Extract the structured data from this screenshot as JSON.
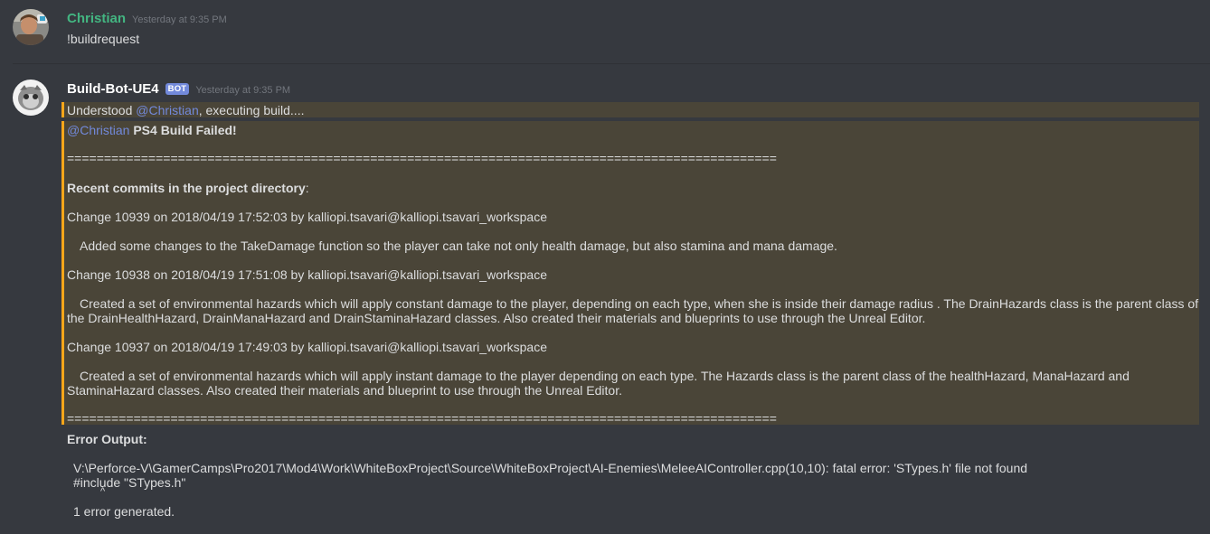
{
  "message1": {
    "username": "Christian",
    "username_color": "#43b581",
    "timestamp": "Yesterday at 9:35 PM",
    "content": "!buildrequest"
  },
  "message2": {
    "username": "Build-Bot-UE4",
    "username_color": "#ffffff",
    "bot_tag": "BOT",
    "timestamp": "Yesterday at 9:35 PM",
    "line1_prefix": "Understood ",
    "line1_mention": "@Christian",
    "line1_suffix": ", executing build....",
    "block": {
      "mention": "@Christian",
      "title": "PS4 Build Failed!",
      "separator": "================================================================================================",
      "recent_label": "Recent commits in the project directory",
      "recent_colon": ":",
      "commits": [
        {
          "change": "Change 10939 on 2018/04/19 17:52:03 by kalliopi.tsavari@kalliopi.tsavari_workspace",
          "description": "Added some changes to the TakeDamage function so the player can take not only health damage, but also stamina and mana damage."
        },
        {
          "change": "Change 10938 on 2018/04/19 17:51:08 by kalliopi.tsavari@kalliopi.tsavari_workspace",
          "description_line1": "Created a set of environmental hazards which will apply constant damage to the player, depending on each type, when she is inside their damage radius . The DrainHazards class is the parent class of",
          "description_line2": "the DrainHealthHazard, DrainManaHazard and DrainStaminaHazard classes. Also created their materials and blueprints to use through the Unreal Editor."
        },
        {
          "change": "Change 10937 on 2018/04/19 17:49:03 by kalliopi.tsavari@kalliopi.tsavari_workspace",
          "description_line1": "Created a set of environmental hazards which will apply instant damage to the player depending on each type. The Hazards class is the parent class of the healthHazard, ManaHazard and",
          "description_line2": "StaminaHazard classes. Also created their materials and blueprint to use through the Unreal Editor."
        }
      ],
      "separator2": "================================================================================================"
    },
    "error": {
      "label": "Error Output:",
      "line1": "V:\\Perforce-V\\GamerCamps\\Pro2017\\Mod4\\Work\\WhiteBoxProject\\Source\\WhiteBoxProject\\AI-Enemies\\MeleeAIController.cpp(10,10):  fatal error: 'STypes.h' file not found",
      "line2": "#include \"STypes.h\"",
      "caret": "^",
      "summary": "1 error generated."
    }
  },
  "colors": {
    "background": "#36393f",
    "highlight": "#4a4538",
    "highlight_border": "#faa61a",
    "mention": "#7289da"
  }
}
